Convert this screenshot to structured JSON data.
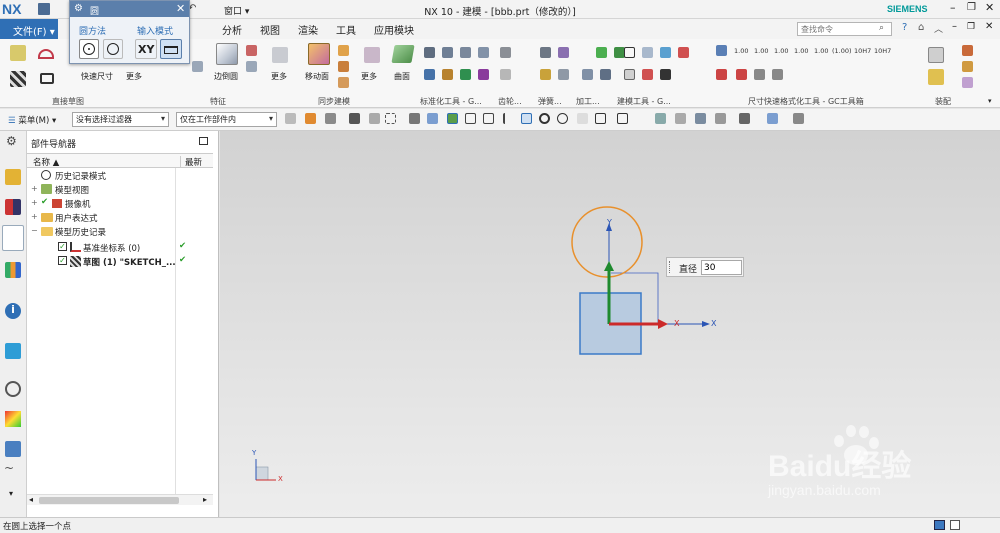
{
  "title_bar": {
    "logo": "NX",
    "window_menu": "窗口",
    "title": "NX 10 - 建模 - [bbb.prt（修改的）]",
    "brand": "SIEMENS"
  },
  "menu_bar": {
    "file": "文件(F)",
    "items": [
      "分析",
      "视图",
      "渲染",
      "工具",
      "应用模块"
    ],
    "search_placeholder": "查找命令"
  },
  "circle_dialog": {
    "title": "圆",
    "method_label": "圆方法",
    "input_mode_label": "输入模式",
    "xy_label": "XY"
  },
  "ribbon": {
    "quick_dim_label": "快速尺寸",
    "more_label": "更多",
    "edge_label": "边倒圆",
    "more2_label": "更多",
    "move_face_label": "移动面",
    "more3_label": "更多",
    "surface_label": "曲面",
    "groups": [
      "直接草图",
      "特征",
      "同步建模",
      "标准化工具 - G...",
      "齿轮...",
      "弹簧...",
      "加工...",
      "建模工具 - G...",
      "尺寸快速格式化工具 - GC工具箱",
      "装配"
    ],
    "dim_values": [
      "1.00",
      "1.00",
      "1.00",
      "1.00",
      "1.00",
      "(1.00)",
      "10H7",
      "10H7"
    ]
  },
  "toolbar2": {
    "menu_label": "菜单(M)",
    "filter": "没有选择过滤器",
    "scope": "仅在工作部件内"
  },
  "navigator": {
    "title": "部件导航器",
    "col_name": "名称",
    "col_latest": "最新",
    "rows": [
      {
        "label": "历史记录模式"
      },
      {
        "label": "模型视图"
      },
      {
        "label": "摄像机"
      },
      {
        "label": "用户表达式"
      },
      {
        "label": "模型历史记录"
      },
      {
        "label": "基准坐标系 (0)"
      },
      {
        "label": "草图 (1) \"SKETCH_..."
      }
    ]
  },
  "viewport": {
    "diameter_label": "直径",
    "diameter_value": "30",
    "axis_x": "X",
    "axis_y": "Y",
    "mini_x": "X",
    "mini_y": "Y",
    "watermark": "Baidu经验",
    "watermark_url": "jingyan.baidu.com"
  },
  "status_bar": {
    "prompt": "在圆上选择一个点"
  },
  "colors": {
    "accent_blue": "#2f6fb5",
    "check_green": "#2a9d2a",
    "circle_orange": "#e8902c"
  }
}
